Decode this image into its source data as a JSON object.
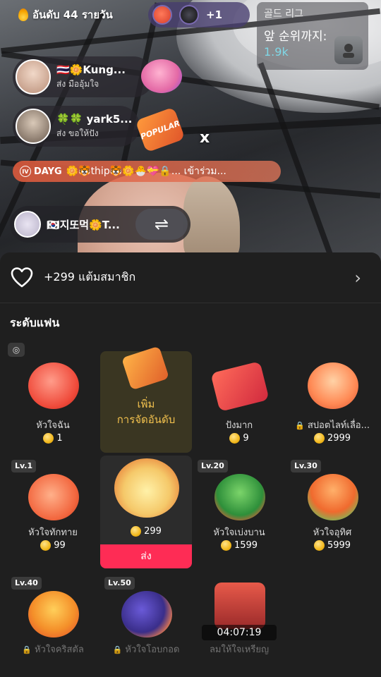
{
  "top_bar": {
    "daily_rank": "อันดับ 44 รายวัน",
    "viewer_extra_count": "+1"
  },
  "league": {
    "title": "골드 리그",
    "label": "앞 순위까지:",
    "value": "1.9k"
  },
  "gift_notifications": [
    {
      "name": "🇹🇭🌼Kung...",
      "action": "ส่ง มืออุ้มใจ",
      "sticker": "heart-hands"
    },
    {
      "name": "🍀🍀 yark5...",
      "action": "ส่ง ขอให้ปัง",
      "sticker": "POPULAR"
    }
  ],
  "combo_marker": "x",
  "join_banner": {
    "level_badge": "IV",
    "team": "DAYG",
    "message": "🌼🐯thip🐯🌼🐣💝🔒... เข้าร่วม..."
  },
  "host": {
    "name": "🇰🇷지또먹🌼T...",
    "swap_icon": "⇌"
  },
  "panel": {
    "member_points": "+299 แต้มสมาชิก",
    "section_title": "ระดับแฟน",
    "gifts": [
      {
        "name": "หัวใจฉัน",
        "price": "1",
        "level": "",
        "locked": false,
        "art": "heart-crown"
      },
      {
        "name": "",
        "price": "",
        "level": "",
        "locked": false,
        "art": "popular-arrow",
        "promo_line1": "เพิ่ม",
        "promo_line2": "การจัดอันดับ"
      },
      {
        "name": "ปังมาก",
        "price": "9",
        "level": "",
        "locked": false,
        "art": "popular-banner"
      },
      {
        "name": "สปอตไลท์เลื่อ...",
        "price": "2999",
        "level": "",
        "locked": true,
        "art": "heart-spotlight"
      },
      {
        "name": "หัวใจทักทาย",
        "price": "99",
        "level": "Lv.1",
        "locked": false,
        "art": "heart-wave"
      },
      {
        "name": "",
        "price": "299",
        "level": "",
        "locked": false,
        "art": "heart-bouquet",
        "send_label": "ส่ง"
      },
      {
        "name": "หัวใจเบ่งบาน",
        "price": "1599",
        "level": "Lv.20",
        "locked": false,
        "art": "heart-bloom"
      },
      {
        "name": "หัวใจอุทิศ",
        "price": "5999",
        "level": "Lv.30",
        "locked": false,
        "art": "heart-tree"
      },
      {
        "name": "หัวใจคริสตัล",
        "price": "",
        "level": "Lv.40",
        "locked": true,
        "art": "heart-crystal"
      },
      {
        "name": "หัวใจโอบกอด",
        "price": "",
        "level": "Lv.50",
        "locked": true,
        "art": "heart-hug"
      },
      {
        "name": "ลมให้ใจเหรียญ",
        "price": "",
        "level": "",
        "locked": false,
        "art": "heart-throne",
        "timer": "04:07:19"
      }
    ]
  }
}
